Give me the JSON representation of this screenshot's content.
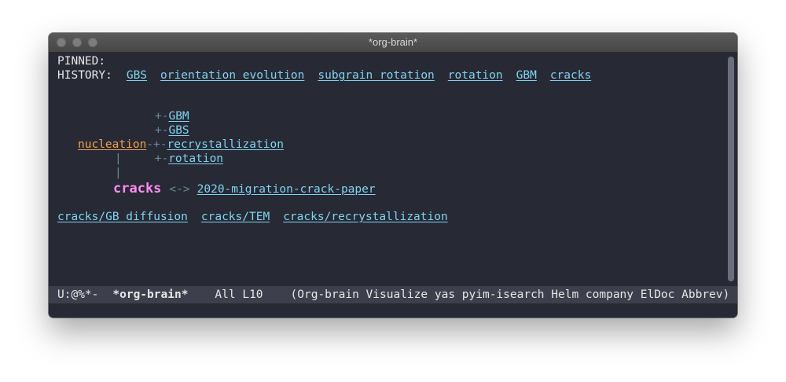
{
  "window": {
    "title": "*org-brain*"
  },
  "buffer": {
    "pinned_label": "PINNED:",
    "history_label": "HISTORY:",
    "history": [
      "GBS",
      "orientation evolution",
      "subgrain rotation",
      "rotation",
      "GBM",
      "cracks"
    ],
    "tree": {
      "children_prefix": "+-",
      "children": [
        "GBM",
        "GBS",
        "recrystallization",
        "rotation"
      ],
      "parent": "nucleation",
      "parent_connector": "-+-",
      "trunk": "|",
      "focus": "cracks",
      "friend_arrow": "<->",
      "friend": "2020-migration-crack-paper"
    },
    "siblings": [
      "cracks/GB diffusion",
      "cracks/TEM",
      "cracks/recrystallization"
    ]
  },
  "modeline": {
    "state": "U:@%*-",
    "buffer_name": "*org-brain*",
    "position": "All L10",
    "modes": "(Org-brain Visualize yas pyim-isearch Helm company ElDoc Abbrev)"
  }
}
